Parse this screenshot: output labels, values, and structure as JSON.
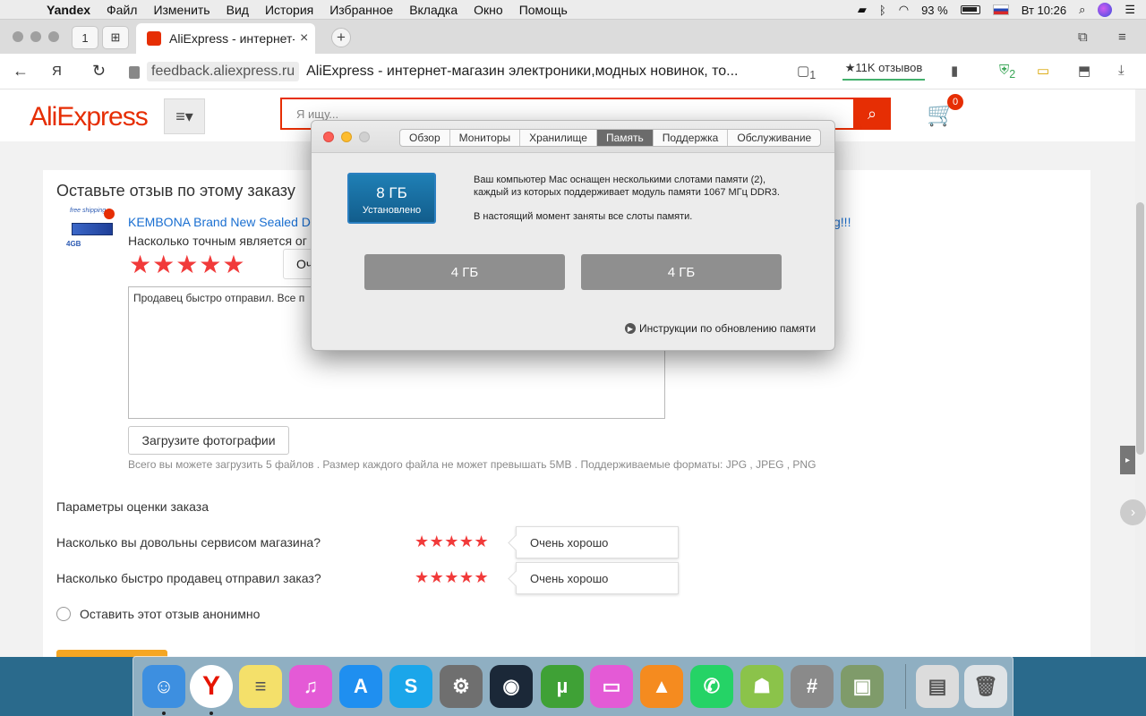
{
  "menubar": {
    "app": "Yandex",
    "items": [
      "Файл",
      "Изменить",
      "Вид",
      "История",
      "Избранное",
      "Вкладка",
      "Окно",
      "Помощь"
    ],
    "battery": "93 %",
    "clock": "Вт 10:26"
  },
  "browser": {
    "home_badge": "1",
    "tab_title": "AliExpress - интернет-магазин электроники",
    "tab_close": "×",
    "new_tab": "+",
    "domain": "feedback.aliexpress.ru",
    "page_title": "AliExpress - интернет-магазин электроники,модных новинок, то...",
    "reviews": "★11K отзывов",
    "ext_badge_1": "1",
    "ext_badge_2": "2"
  },
  "site": {
    "logo": "AliExpress",
    "search_placeholder": "Я ищу...",
    "cart_count": "0"
  },
  "review": {
    "heading": "Оставьте отзыв по этому заказу",
    "thumb_free": "free shipping",
    "thumb_size": "4GB",
    "product_title": "KEMBONA Brand New Sealed DD",
    "product_title_tail": "g!!!",
    "accuracy_question": "Насколько точным является ог",
    "accuracy_stars": "★★★★★",
    "accuracy_rating_partial": "Оч",
    "text": "Продавец быстро отправил. Все п",
    "upload_button": "Загрузите фотографии",
    "upload_hint": "Всего вы можете загрузить 5 файлов . Размер каждого файла не может превышать 5MB . Поддерживаемые форматы: JPG , JPEG , PNG",
    "params_heading": "Параметры оценки заказа",
    "params": [
      {
        "label": "Насколько вы довольны сервисом магазина?",
        "stars": "★★★★★",
        "rating": "Очень хорошо"
      },
      {
        "label": "Насколько быстро продавец отправил заказ?",
        "stars": "★★★★★",
        "rating": "Очень хорошо"
      }
    ],
    "anonymous_label": "Оставить этот отзыв анонимно"
  },
  "dialog": {
    "tabs": [
      "Обзор",
      "Мониторы",
      "Хранилище",
      "Память",
      "Поддержка",
      "Обслуживание"
    ],
    "active_tab": "Память",
    "total_value": "8 ГБ",
    "total_sub": "Установлено",
    "desc_1": "Ваш компьютер Mac оснащен несколькими слотами памяти (2),",
    "desc_2": "каждый из которых поддерживает модуль памяти 1067 МГц DDR3.",
    "desc_3": "В настоящий момент заняты все слоты памяти.",
    "slots": [
      "4 ГБ",
      "4 ГБ"
    ],
    "upgrade_link": "Инструкции по обновлению памяти"
  },
  "dock": [
    {
      "name": "Finder",
      "color": "#3d8fe0",
      "glyph": "☺"
    },
    {
      "name": "Yandex",
      "color": "#ffffff",
      "glyph": "Y"
    },
    {
      "name": "Notes",
      "color": "#f4e06a",
      "glyph": "≡"
    },
    {
      "name": "iTunes",
      "color": "#e45ad6",
      "glyph": "♫"
    },
    {
      "name": "App Store",
      "color": "#1f8ff0",
      "glyph": "A"
    },
    {
      "name": "Skype",
      "color": "#1ba6ea",
      "glyph": "S"
    },
    {
      "name": "System Preferences",
      "color": "#6f6f6f",
      "glyph": "⚙"
    },
    {
      "name": "Steam",
      "color": "#1b2838",
      "glyph": "◉"
    },
    {
      "name": "uTorrent",
      "color": "#3fa136",
      "glyph": "µ"
    },
    {
      "name": "CleanMyMac",
      "color": "#e45ad6",
      "glyph": "▭"
    },
    {
      "name": "VLC",
      "color": "#f58b1f",
      "glyph": "▲"
    },
    {
      "name": "WhatsApp",
      "color": "#25d366",
      "glyph": "✆"
    },
    {
      "name": "Android File Transfer",
      "color": "#8bc34a",
      "glyph": "☗"
    },
    {
      "name": "Calculator",
      "color": "#8a8a8a",
      "glyph": "#"
    },
    {
      "name": "Archive Utility",
      "color": "#7f9b6a",
      "glyph": "▣"
    },
    {
      "name": "Downloads",
      "color": "#dcdcdc",
      "glyph": "▤"
    },
    {
      "name": "Trash",
      "color": "#dfe3e6",
      "glyph": "🗑"
    }
  ]
}
